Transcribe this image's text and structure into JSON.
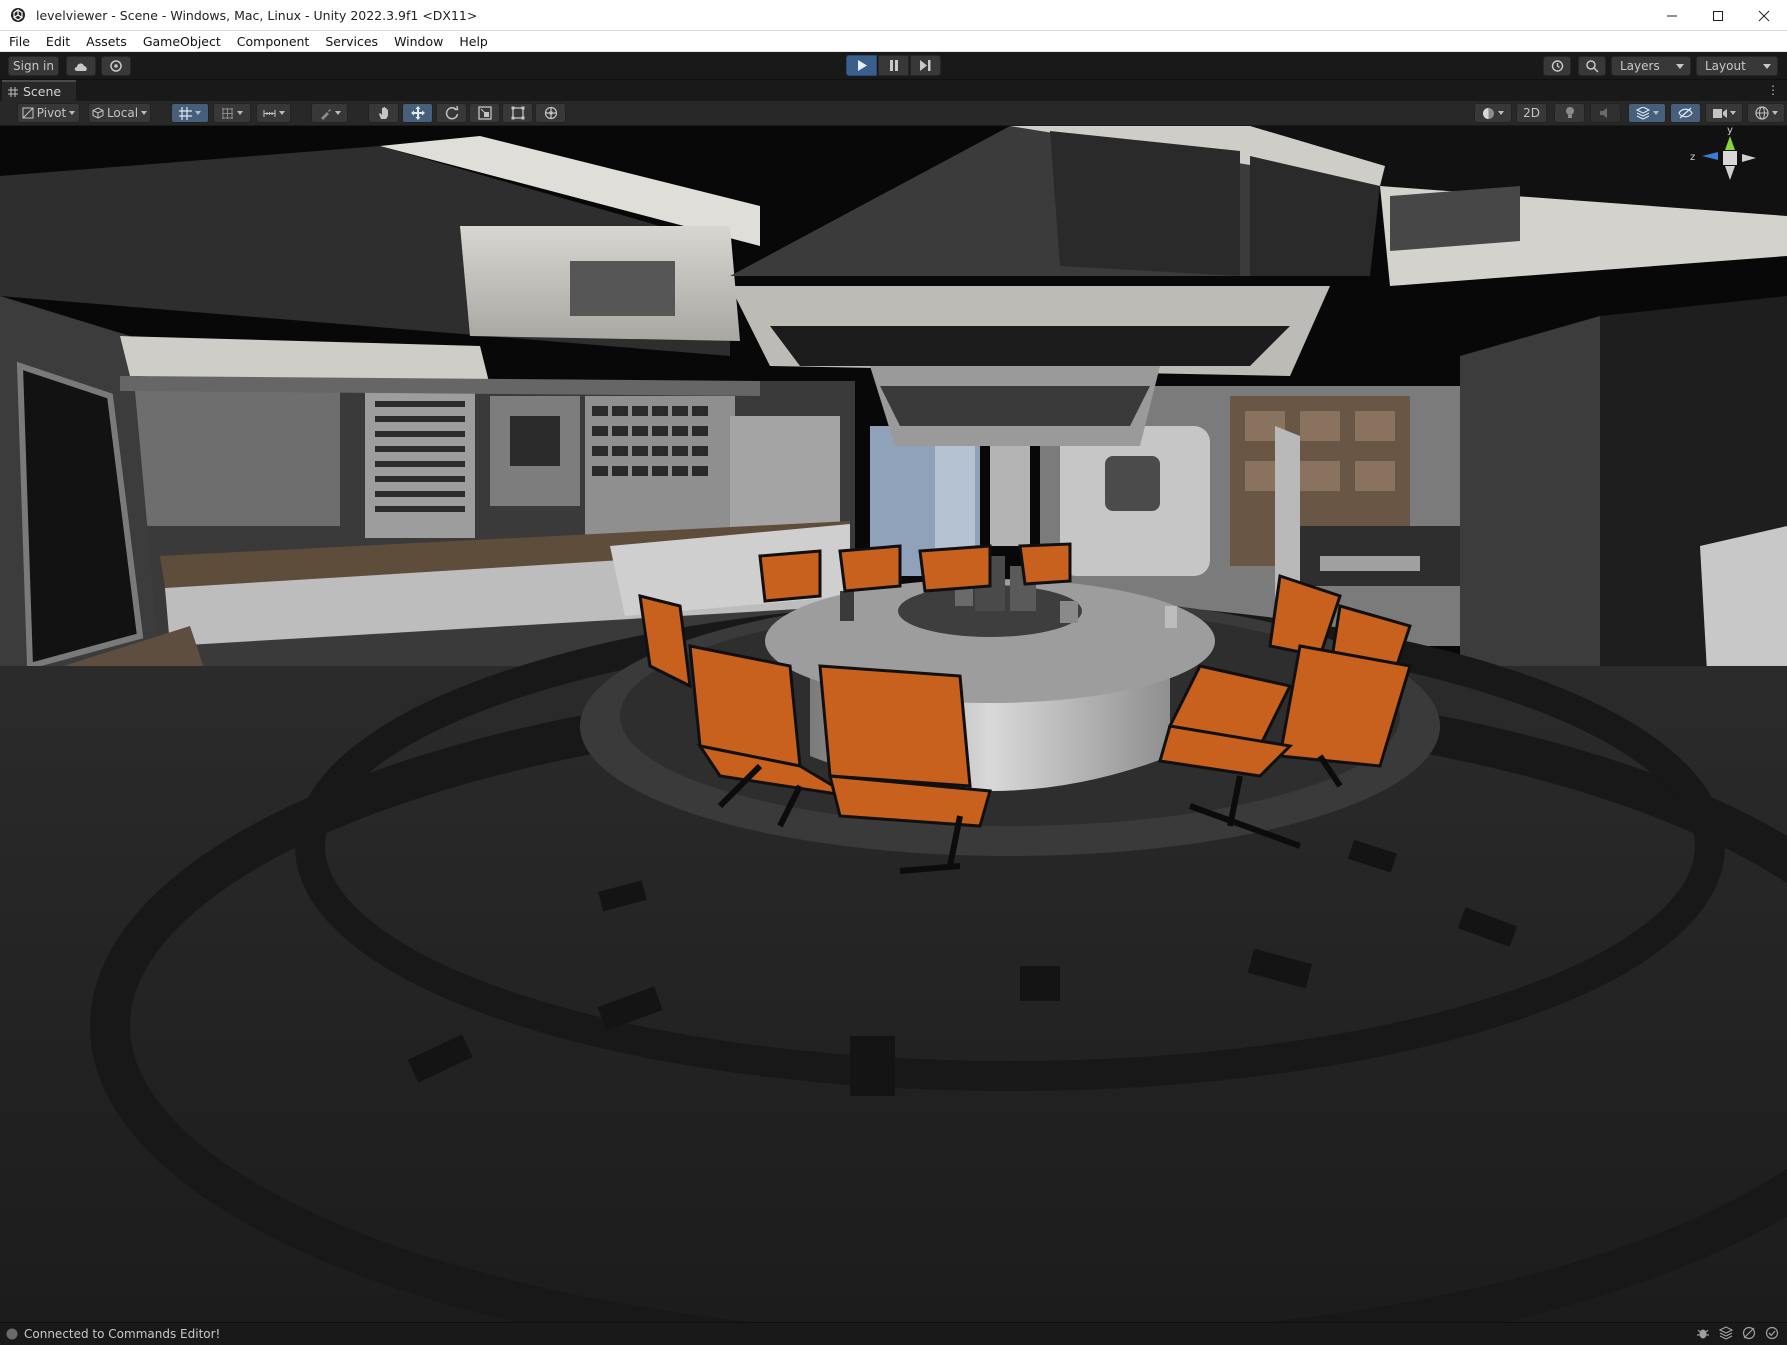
{
  "window": {
    "title": "levelviewer - Scene - Windows, Mac, Linux - Unity 2022.3.9f1 <DX11>",
    "icon": "unity-logo-icon",
    "controls": [
      "minimize-icon",
      "maximize-icon",
      "close-icon"
    ]
  },
  "menu": {
    "items": [
      "File",
      "Edit",
      "Assets",
      "GameObject",
      "Component",
      "Services",
      "Window",
      "Help"
    ]
  },
  "toolbar": {
    "signin_label": "Sign in",
    "play_state": "playing",
    "layers_label": "Layers",
    "layout_label": "Layout"
  },
  "scene_tab": {
    "label": "Scene"
  },
  "scene_tools": {
    "pivot_label": "Pivot",
    "space_label": "Local",
    "mode_2d_label": "2D"
  },
  "status": {
    "message": "Connected to Commands Editor!"
  },
  "colors": {
    "editor_bg": "#191919",
    "panel_bg": "#282828",
    "button_bg": "#383838",
    "play_active": "#3a5f8c",
    "chair_orange": "#c8601e"
  }
}
